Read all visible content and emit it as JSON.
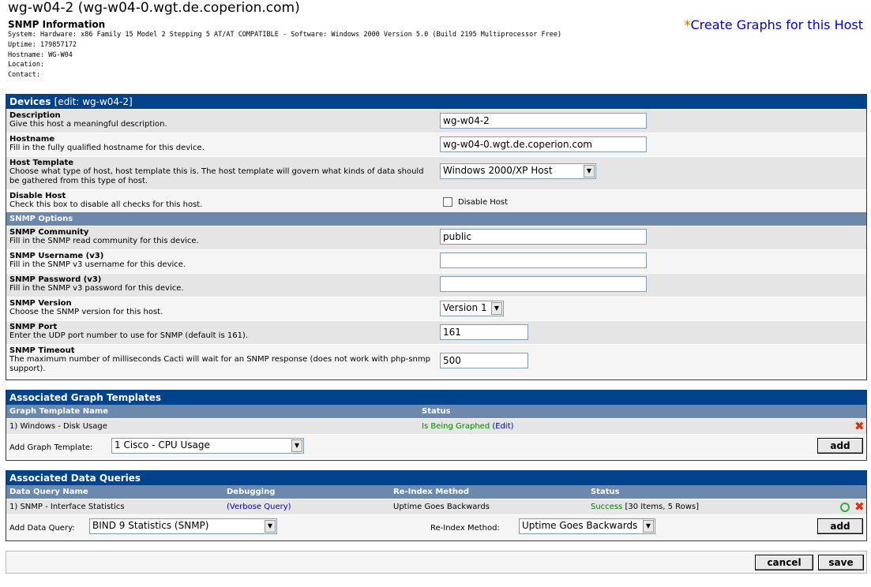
{
  "header": {
    "host_title": "wg-w04-2 (wg-w04-0.wgt.de.coperion.com)",
    "snmp_heading": "SNMP Information",
    "system": "System: Hardware: x86 Family 15 Model 2 Stepping 5 AT/AT COMPATIBLE - Software: Windows 2000 Version 5.0 (Build 2195 Multiprocessor Free)",
    "uptime": "Uptime: 179857172",
    "hostname": "Hostname: WG-W04",
    "location": "Location:",
    "contact": "Contact:",
    "create_star": "*",
    "create_link": "Create Graphs for this Host"
  },
  "devices": {
    "title": "Devices",
    "edit_label": "[edit: wg-w04-2]",
    "fields": {
      "description": {
        "label": "Description",
        "help": "Give this host a meaningful description.",
        "value": "wg-w04-2"
      },
      "hostname": {
        "label": "Hostname",
        "help": "Fill in the fully qualified hostname for this device.",
        "value": "wg-w04-0.wgt.de.coperion.com"
      },
      "host_template": {
        "label": "Host Template",
        "help": "Choose what type of host, host template this is. The host template will govern what kinds of data should be gathered from this type of host.",
        "value": "Windows 2000/XP Host"
      },
      "disable_host": {
        "label": "Disable Host",
        "help": "Check this box to disable all checks for this host.",
        "checkbox_label": "Disable Host"
      }
    },
    "snmp_options_heading": "SNMP Options",
    "snmp": {
      "community": {
        "label": "SNMP Community",
        "help": "Fill in the SNMP read community for this device.",
        "value": "public"
      },
      "username": {
        "label": "SNMP Username (v3)",
        "help": "Fill in the SNMP v3 username for this device.",
        "value": ""
      },
      "password": {
        "label": "SNMP Password (v3)",
        "help": "Fill in the SNMP v3 password for this device.",
        "value": ""
      },
      "version": {
        "label": "SNMP Version",
        "help": "Choose the SNMP version for this host.",
        "value": "Version 1"
      },
      "port": {
        "label": "SNMP Port",
        "help": "Enter the UDP port number to use for SNMP (default is 161).",
        "value": "161"
      },
      "timeout": {
        "label": "SNMP Timeout",
        "help": "The maximum number of milliseconds Cacti will wait for an SNMP response (does not work with php-snmp support).",
        "value": "500"
      }
    }
  },
  "graph_templates": {
    "title": "Associated Graph Templates",
    "col_name": "Graph Template Name",
    "col_status": "Status",
    "rows": [
      {
        "name": "1) Windows - Disk Usage",
        "status": "Is Being Graphed",
        "open": "(",
        "edit": "Edit",
        "close": ")"
      }
    ],
    "add_label": "Add Graph Template:",
    "add_value": "1 Cisco - CPU Usage",
    "add_button": "add"
  },
  "data_queries": {
    "title": "Associated Data Queries",
    "col_name": "Data Query Name",
    "col_debug": "Debugging",
    "col_reindex": "Re-Index Method",
    "col_status": "Status",
    "rows": [
      {
        "name": "1) SNMP - Interface Statistics",
        "debug_open": "(",
        "debug": "Verbose Query",
        "debug_close": ")",
        "reindex": "Uptime Goes Backwards",
        "status": "Success",
        "status_detail": "[30 Items, 5 Rows]"
      }
    ],
    "add_label": "Add Data Query:",
    "add_value": "BIND 9 Statistics (SNMP)",
    "reindex_label": "Re-Index Method:",
    "reindex_value": "Uptime Goes Backwards",
    "add_button": "add"
  },
  "footer": {
    "cancel": "cancel",
    "save": "save"
  }
}
